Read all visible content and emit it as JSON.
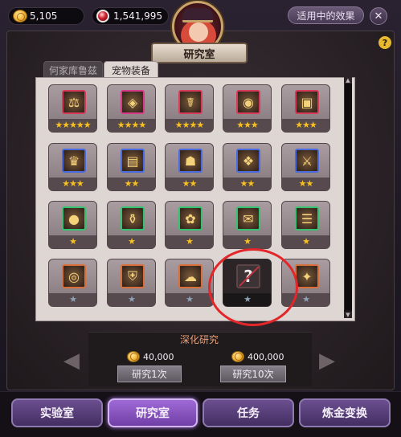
{
  "header": {
    "gold": "5,105",
    "gems": "1,541,995",
    "effects_button": "适用中的效果",
    "close_symbol": "✕",
    "title": "研究室",
    "help_symbol": "?"
  },
  "tabs": [
    {
      "label": "何家库鲁兹",
      "active": false
    },
    {
      "label": "宠物装备",
      "active": true
    }
  ],
  "grid": {
    "rows": [
      [
        {
          "icon": "scales-icon",
          "glyph": "⚖",
          "stars": 5
        },
        {
          "icon": "pendant-icon",
          "glyph": "◈",
          "stars": 4
        },
        {
          "icon": "caduceus-icon",
          "glyph": "☤",
          "stars": 4
        },
        {
          "icon": "medal-icon",
          "glyph": "◉",
          "stars": 3
        },
        {
          "icon": "chest-icon",
          "glyph": "▣",
          "stars": 3
        }
      ],
      [
        {
          "icon": "crown-icon",
          "glyph": "♛",
          "stars": 3
        },
        {
          "icon": "spellbook-icon",
          "glyph": "▤",
          "stars": 2
        },
        {
          "icon": "ghost-icon",
          "glyph": "☗",
          "stars": 2
        },
        {
          "icon": "wing-icon",
          "glyph": "❖",
          "stars": 2
        },
        {
          "icon": "sword-icon",
          "glyph": "⚔",
          "stars": 2
        }
      ],
      [
        {
          "icon": "orb-icon",
          "glyph": "●",
          "stars": 1
        },
        {
          "icon": "potion-icon",
          "glyph": "⚱",
          "stars": 1
        },
        {
          "icon": "flower-icon",
          "glyph": "✿",
          "stars": 1
        },
        {
          "icon": "scroll-icon",
          "glyph": "✉",
          "stars": 1
        },
        {
          "icon": "paper-icon",
          "glyph": "☰",
          "stars": 1
        }
      ],
      [
        {
          "icon": "ring-icon",
          "glyph": "◎",
          "stars": 1,
          "gray": true
        },
        {
          "icon": "armor-icon",
          "glyph": "⛨",
          "stars": 1,
          "gray": true
        },
        {
          "icon": "bear-icon",
          "glyph": "☁",
          "stars": 1,
          "gray": true
        },
        {
          "icon": "unknown-icon",
          "glyph": "?",
          "stars": 1,
          "gray": true,
          "unknown": true
        },
        {
          "icon": "wand-icon",
          "glyph": "✦",
          "stars": 1,
          "gray": true
        }
      ]
    ]
  },
  "research": {
    "title": "深化研究",
    "cost_1": "40,000",
    "cost_10": "400,000",
    "button_1": "研究1次",
    "button_10": "研究10次"
  },
  "bottom_nav": [
    {
      "label": "实验室",
      "active": false
    },
    {
      "label": "研究室",
      "active": true
    },
    {
      "label": "任务",
      "active": false
    },
    {
      "label": "炼金变换",
      "active": false
    }
  ],
  "colors": {
    "star": "#f5c028",
    "highlight_circle": "#e3262a",
    "active_tab": "#ddd6d3"
  }
}
